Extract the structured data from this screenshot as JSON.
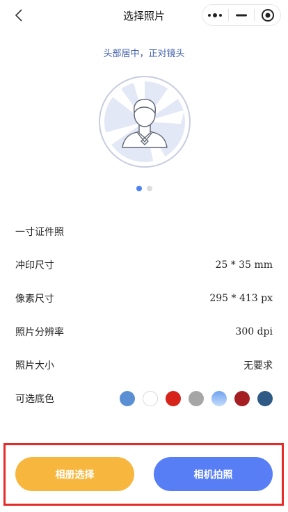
{
  "nav": {
    "title": "选择照片",
    "back_icon": "chevron-left-icon",
    "more_icon": "more-dots-icon",
    "minimize_icon": "minimize-icon",
    "close_icon": "target-close-icon"
  },
  "tip": "头部居中，正对镜头",
  "carousel": {
    "slide_count": 2,
    "active_index": 0
  },
  "photo": {
    "name": "一寸证件照",
    "rows": [
      {
        "label": "冲印尺寸",
        "value": "25 * 35 mm"
      },
      {
        "label": "像素尺寸",
        "value": "295 * 413 px"
      },
      {
        "label": "照片分辨率",
        "value": "300 dpi"
      },
      {
        "label": "照片大小",
        "value": "无要求"
      }
    ],
    "color_label": "可选底色",
    "colors": [
      "#5b8fd3",
      "#ffffff",
      "#d6241b",
      "#a6a6a6",
      "#8eb9f3",
      "#a51e22",
      "#2e5a85"
    ]
  },
  "actions": {
    "album_label": "相册选择",
    "camera_label": "相机拍照",
    "album_color": "#f7b73e",
    "camera_color": "#577ef5",
    "highlight_color": "#e52a2a"
  }
}
